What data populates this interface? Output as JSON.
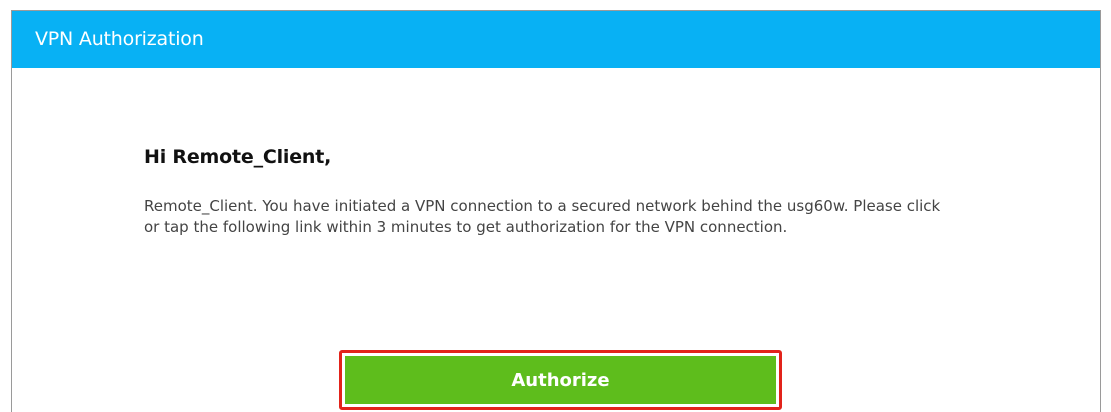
{
  "window": {
    "title": "VPN Authorization"
  },
  "content": {
    "greeting": "Hi Remote_Client,",
    "message": "Remote_Client. You have initiated a VPN connection to a secured network behind the usg60w. Please click or tap the following link within 3 minutes to get authorization for the VPN connection."
  },
  "actions": {
    "authorize_label": "Authorize"
  },
  "colors": {
    "header": "#08b1f4",
    "button": "#5ebd1c",
    "highlight": "#e2231a"
  }
}
